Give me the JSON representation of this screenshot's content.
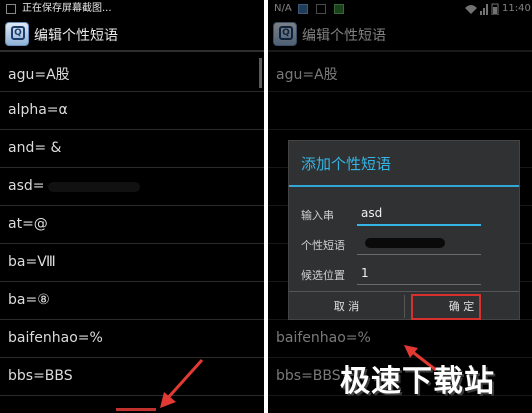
{
  "left_screen": {
    "status_text": "正在保存屏幕截图...",
    "title": "编辑个性短语",
    "items": [
      {
        "label": "agu=A股"
      },
      {
        "label": "alpha=α"
      },
      {
        "label": "and= &"
      },
      {
        "label": "asd="
      },
      {
        "label": "at=@"
      },
      {
        "label": "ba=Ⅷ"
      },
      {
        "label": "ba=⑧"
      },
      {
        "label": "baifenhao=%"
      },
      {
        "label": "bbs=BBS"
      }
    ]
  },
  "right_screen": {
    "status_left": "N/A",
    "status_time": "11:40",
    "title": "编辑个性短语",
    "items": [
      {
        "label": "agu=A股"
      },
      {
        "label": "baifenhao=%"
      },
      {
        "label": "bbs=BBS"
      }
    ],
    "dialog": {
      "title": "添加个性短语",
      "fields": [
        {
          "label": "输入串",
          "value": "asd"
        },
        {
          "label": "个性短语",
          "value": ""
        },
        {
          "label": "候选位置",
          "value": "1"
        }
      ],
      "cancel_label": "取 消",
      "confirm_label": "确 定"
    }
  },
  "watermark": "极速下载站",
  "colors": {
    "accent": "#35b5e5",
    "highlight": "#d6312e"
  },
  "icons": [
    "app-icon",
    "arrow-icon",
    "wifi-icon",
    "signal-icon",
    "battery-icon"
  ]
}
